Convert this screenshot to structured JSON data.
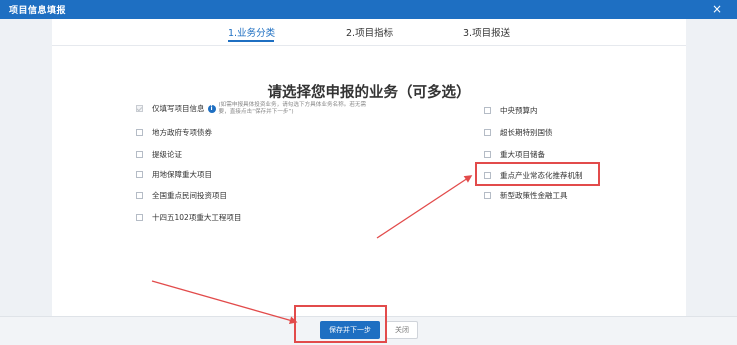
{
  "window": {
    "title": "项目信息填报",
    "close_icon": "×"
  },
  "steps": [
    {
      "label": "1.业务分类",
      "active": true
    },
    {
      "label": "2.项目指标",
      "active": false
    },
    {
      "label": "3.项目报送",
      "active": false
    }
  ],
  "heading": "请选择您申报的业务（可多选）",
  "left_options": [
    {
      "label": "仅填写项目信息",
      "checked": true,
      "disabled": true,
      "info_icon": "i",
      "hint": "(如需申报具体投资业务，请勾选下方具体业务名称。若无需要，直接点击“保存并下一步”)"
    },
    {
      "label": "地方政府专项债券",
      "checked": false
    },
    {
      "label": "提级论证",
      "checked": false
    },
    {
      "label": "用地保障重大项目",
      "checked": false
    },
    {
      "label": "全国重点民间投资项目",
      "checked": false
    },
    {
      "label": "十四五102项重大工程项目",
      "checked": false
    }
  ],
  "right_options": [
    {
      "label": "中央预算内",
      "checked": false
    },
    {
      "label": "超长期特别国债",
      "checked": false
    },
    {
      "label": "重大项目储备",
      "checked": false
    },
    {
      "label": "重点产业常态化推荐机制",
      "checked": false
    },
    {
      "label": "新型政策性金融工具",
      "checked": false
    }
  ],
  "footer": {
    "save_next_label": "保存并下一步",
    "close_label": "关闭"
  },
  "colors": {
    "primary": "#1e6fc2",
    "annotation": "#e24b4b"
  }
}
